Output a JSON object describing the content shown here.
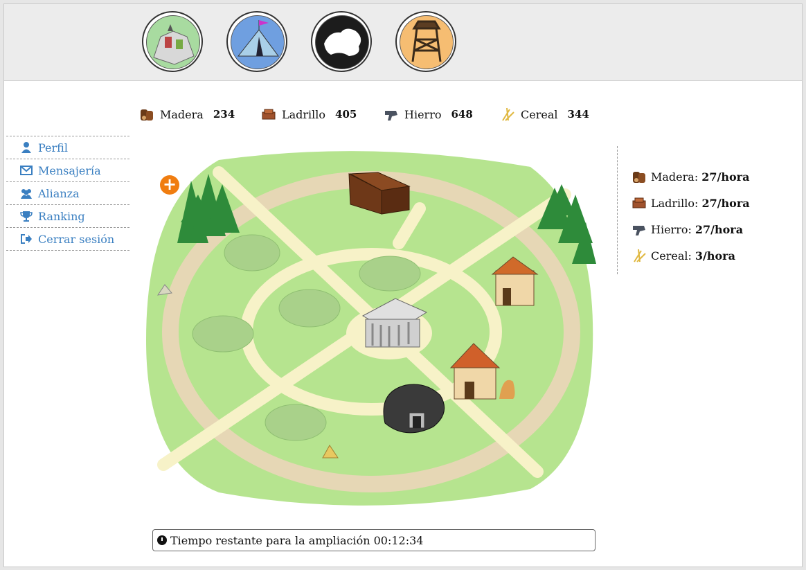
{
  "nav": [
    {
      "name": "castle",
      "bg": "#a8dba0"
    },
    {
      "name": "tent",
      "bg": "#6f9fe0"
    },
    {
      "name": "map",
      "bg": "#1c1c1c"
    },
    {
      "name": "watchtower",
      "bg": "#f6bd72"
    }
  ],
  "resources": [
    {
      "label": "Madera",
      "value": "234",
      "icon": "wood-icon"
    },
    {
      "label": "Ladrillo",
      "value": "405",
      "icon": "brick-icon"
    },
    {
      "label": "Hierro",
      "value": "648",
      "icon": "iron-icon"
    },
    {
      "label": "Cereal",
      "value": "344",
      "icon": "grain-icon"
    }
  ],
  "sidebar": [
    {
      "label": "Perfil",
      "icon": "user-icon"
    },
    {
      "label": "Mensajería",
      "icon": "envelope-icon"
    },
    {
      "label": "Alianza",
      "icon": "users-icon"
    },
    {
      "label": "Ranking",
      "icon": "trophy-icon"
    },
    {
      "label": "Cerrar sesión",
      "icon": "sign-out-icon"
    }
  ],
  "production": [
    {
      "label": "Madera:",
      "rate": "27/hora"
    },
    {
      "label": "Ladrillo:",
      "rate": "27/hora"
    },
    {
      "label": "Hierro:",
      "rate": "27/hora"
    },
    {
      "label": "Cereal:",
      "rate": "3/hora"
    }
  ],
  "timer": {
    "text": "Tiempo restante para la ampliación 00:12:34"
  },
  "colors": {
    "link": "#3a7fc1",
    "add": "#f07d10",
    "grass": "#b6e48f",
    "path": "#f7f2c8",
    "ring": "#e6d7b5"
  }
}
